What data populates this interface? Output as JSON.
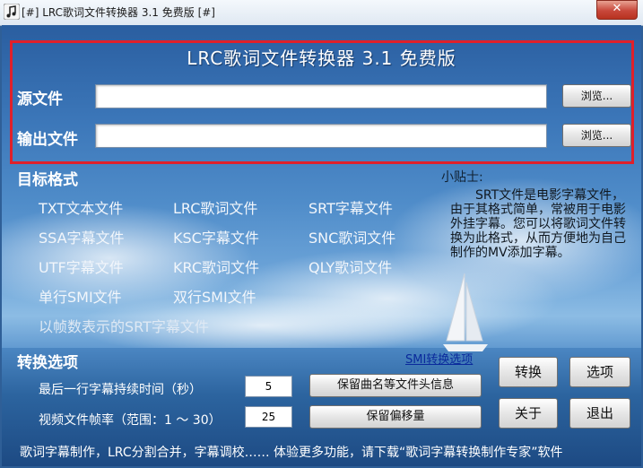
{
  "window": {
    "title": "[#] LRC歌词文件转换器 3.1 免费版 [#]",
    "close_label": "✕"
  },
  "header": {
    "title": "LRC歌词文件转换器 3.1 免费版"
  },
  "source": {
    "label": "源文件",
    "value": "",
    "browse_label": "浏览..."
  },
  "output": {
    "label": "输出文件",
    "value": "",
    "browse_label": "浏览..."
  },
  "formats": {
    "heading": "目标格式",
    "items": [
      "TXT文本文件",
      "LRC歌词文件",
      "SRT字幕文件",
      "SSA字幕文件",
      "KSC字幕文件",
      "SNC歌词文件",
      "UTF字幕文件",
      "KRC歌词文件",
      "QLY歌词文件",
      "单行SMI文件",
      "双行SMI文件",
      "以帧数表示的SRT字幕文件"
    ]
  },
  "tip": {
    "title": "小贴士:",
    "body": "SRT文件是电影字幕文件，由于其格式简单，常被用于电影外挂字幕。您可以将歌词文件转换为此格式，从而方便地为自己制作的MV添加字幕。"
  },
  "options": {
    "heading": "转换选项",
    "smi_link": "SMI转换选项",
    "last_duration_label": "最后一行字幕持续时间（秒）",
    "last_duration_value": "5",
    "framerate_label": "视频文件帧率（范围：1 ～ 30）",
    "framerate_value": "25",
    "keep_header_label": "保留曲名等文件头信息",
    "keep_offset_label": "保留偏移量"
  },
  "actions": {
    "convert": "转换",
    "options": "选项",
    "about": "关于",
    "exit": "退出"
  },
  "footer": {
    "text": "歌词字幕制作，LRC分割合并，字幕调校…… 体验更多功能，请下载“歌词字幕转换制作专家”软件"
  },
  "colors": {
    "highlight": "#e0202a",
    "background": "#3c77b9"
  }
}
